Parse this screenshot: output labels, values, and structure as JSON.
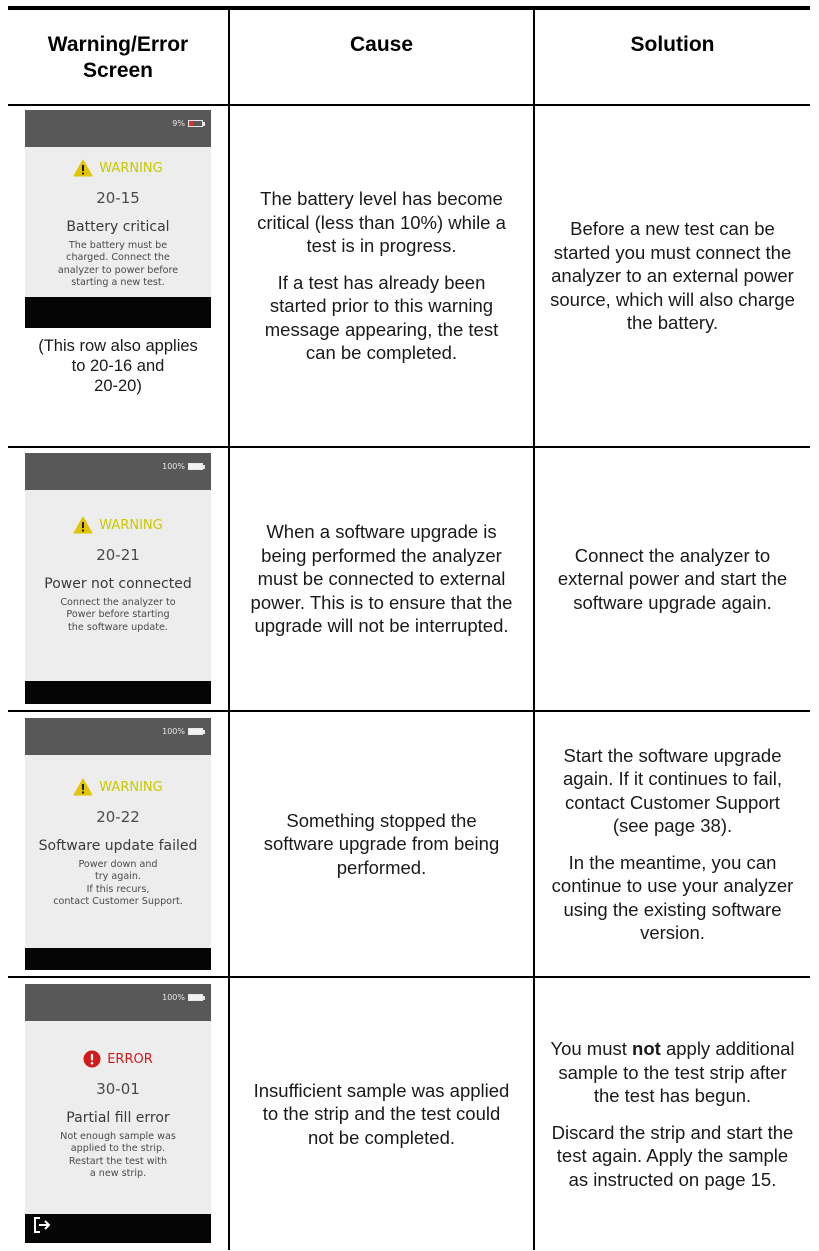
{
  "headers": {
    "screen": "Warning/Error Screen",
    "cause": "Cause",
    "solution": "Solution"
  },
  "rows": [
    {
      "device": {
        "battery_text": "9%",
        "battery_level": 0.09,
        "alert_type": "warning",
        "alert_label": "WARNING",
        "code": "20-15",
        "title": "Battery critical",
        "message": [
          "The battery must be",
          "charged. Connect the",
          "analyzer to power before",
          "starting a new test."
        ]
      },
      "note": [
        "(This row also applies",
        "to 20-16 and",
        "20-20)"
      ],
      "cause": [
        "The battery level has become critical (less than 10%) while a test is in progress.",
        "If a test has already been started prior to this warning message appearing, the test can be completed."
      ],
      "solution": [
        "Before a new test can be started you must connect the analyzer to an external power source, which will also charge the battery."
      ]
    },
    {
      "device": {
        "battery_text": "100%",
        "battery_level": 1.0,
        "alert_type": "warning",
        "alert_label": "WARNING",
        "code": "20-21",
        "title": "Power not connected",
        "message": [
          "Connect the analyzer to",
          "Power before starting",
          "the software update."
        ]
      },
      "cause": [
        "When a software upgrade is being performed the analyzer must be connected to external power. This is to ensure that the upgrade will not be interrupted."
      ],
      "solution": [
        "Connect the analyzer to external power and start the software upgrade again."
      ]
    },
    {
      "device": {
        "battery_text": "100%",
        "battery_level": 1.0,
        "alert_type": "warning",
        "alert_label": "WARNING",
        "code": "20-22",
        "title": "Software update failed",
        "message": [
          "Power down and",
          "try again.",
          "If this recurs,",
          "contact Customer Support."
        ]
      },
      "cause": [
        "Something stopped the software upgrade from being performed."
      ],
      "solution": [
        "Start the software upgrade again. If it continues to fail, contact Customer Support (see page 38).",
        "In the meantime, you can continue to use your analyzer using the existing software version."
      ]
    },
    {
      "device": {
        "battery_text": "100%",
        "battery_level": 1.0,
        "alert_type": "error",
        "alert_label": "ERROR",
        "code": "30-01",
        "title": "Partial fill error",
        "message": [
          "Not enough sample was",
          "applied to the strip.",
          "Restart the test with",
          "a new strip."
        ]
      },
      "cause": [
        "Insufficient sample was applied to the strip and the test could not be completed."
      ],
      "solution_parts": {
        "p1_before": "You must ",
        "p1_bold": "not",
        "p1_after": " apply additional sample to the test strip after the test has begun.",
        "p2": "Discard the strip and start the test again. Apply the sample as instructed on page 15."
      }
    }
  ],
  "colors": {
    "warning_text": "#c9c800",
    "warning_triangle": "#e2c400",
    "error": "#d11a1a",
    "battery_low": "#e03030",
    "battery_full": "#f2f2f2"
  },
  "icons": {
    "warning": "warning-triangle-icon",
    "error": "error-circle-icon",
    "battery": "battery-icon",
    "exit": "exit-arrow-icon"
  }
}
